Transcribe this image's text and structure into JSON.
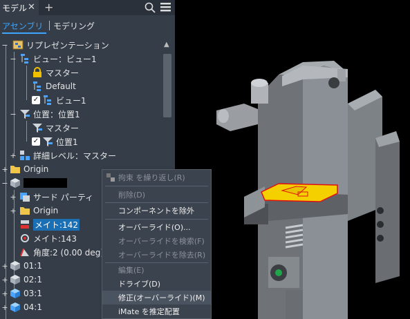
{
  "tab": {
    "label": "モデル",
    "close": "✕",
    "add": "+"
  },
  "subtabs": {
    "assembly": "アセンブリ",
    "modeling": "モデリング"
  },
  "tree": {
    "representations": "リプレゼンテーション",
    "view": "ビュー：ビュー1",
    "master1": "マスター",
    "default": "Default",
    "view1": "ビュー1",
    "position": "位置：位置1",
    "master2": "マスター",
    "position1": "位置1",
    "detail": "詳細レベル：マスター",
    "origin1": "Origin",
    "thirdparty": "サード パーティ",
    "origin2": "Origin",
    "mate142": "メイト:142",
    "mate143": "メイト:143",
    "angle": "角度:2 (0.00 deg)",
    "item01": "01:1",
    "item02": "02:1",
    "item03": "03:1",
    "item04": "04:1"
  },
  "context_menu": {
    "items": [
      {
        "label": "拘束 を繰り返し(R)",
        "enabled": false
      },
      {
        "label": "削除(D)",
        "enabled": false
      },
      {
        "label": "コンポーネントを除外",
        "enabled": true
      },
      {
        "label": "オーバーライド(O)...",
        "enabled": true
      },
      {
        "label": "オーバーライドを検索(F)",
        "enabled": false
      },
      {
        "label": "オーバーライドを除去(R)",
        "enabled": false
      },
      {
        "label": "編集(E)",
        "enabled": false
      },
      {
        "label": "ドライブ(D)",
        "enabled": true
      },
      {
        "label": "修正(オーバーライド)(M)",
        "enabled": true
      },
      {
        "label": "iMate を推定配置",
        "enabled": true
      }
    ]
  },
  "colors": {
    "panel": "#343d48",
    "accent": "#3ea6ff",
    "selection": "#1b6fb5",
    "highlight_part": "#f5d000",
    "highlight_edge": "#e01010"
  }
}
